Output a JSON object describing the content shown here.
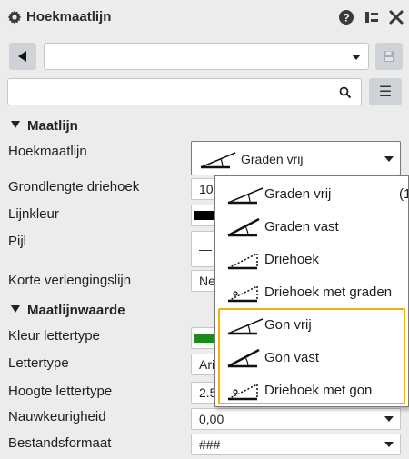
{
  "window": {
    "title": "Hoekmaatlijn",
    "icons": [
      "gear-icon",
      "help-icon",
      "pin-panel-icon",
      "close-icon"
    ]
  },
  "toolbar": {
    "back_icon": "triangle-left-icon",
    "style_value": "",
    "save_icon": "save-icon"
  },
  "search": {
    "value": "",
    "placeholder": "",
    "icon": "search-icon",
    "menu_icon": "menu-icon",
    "menu_glyph": "☰"
  },
  "sections": {
    "maatlijn": {
      "title": "Maatlijn",
      "hoekmaatlijn": {
        "label": "Hoekmaatlijn",
        "value": "Graden vrij"
      },
      "grondlengte": {
        "label": "Grondlengte driehoek",
        "value": "10"
      },
      "lijnkleur": {
        "label": "Lijnkleur",
        "color": "#000000"
      },
      "pijl": {
        "label": "Pijl",
        "value": "—"
      },
      "korte": {
        "label": "Korte verlengingslijn",
        "value": "Ne"
      }
    },
    "maatlijnwaarde": {
      "title": "Maatlijnwaarde",
      "kleur": {
        "label": "Kleur lettertype",
        "color": "#1a8a1a"
      },
      "lettertype": {
        "label": "Lettertype",
        "value": "Ari"
      },
      "hoogte": {
        "label": "Hoogte lettertype",
        "value": "2.5"
      },
      "nauwkeurigheid": {
        "label": "Nauwkeurigheid",
        "value": "0,00"
      },
      "bestandsformaat": {
        "label": "Bestandsformaat",
        "value": "###"
      }
    }
  },
  "dropdown": {
    "items": [
      {
        "label": "Graden vrij",
        "extra": "(1",
        "icon": "angle-free-icon"
      },
      {
        "label": "Graden vast",
        "extra": "",
        "icon": "angle-fixed-icon"
      },
      {
        "label": "Driehoek",
        "extra": "",
        "icon": "triangle-icon"
      },
      {
        "label": "Driehoek met graden",
        "extra": "",
        "icon": "triangle-degrees-icon"
      },
      {
        "label": "Gon vrij",
        "extra": "",
        "icon": "angle-free-icon"
      },
      {
        "label": "Gon vast",
        "extra": "",
        "icon": "angle-fixed-icon"
      },
      {
        "label": "Driehoek met gon",
        "extra": "",
        "icon": "triangle-gon-icon"
      }
    ],
    "highlight_color": "#f0b400"
  }
}
